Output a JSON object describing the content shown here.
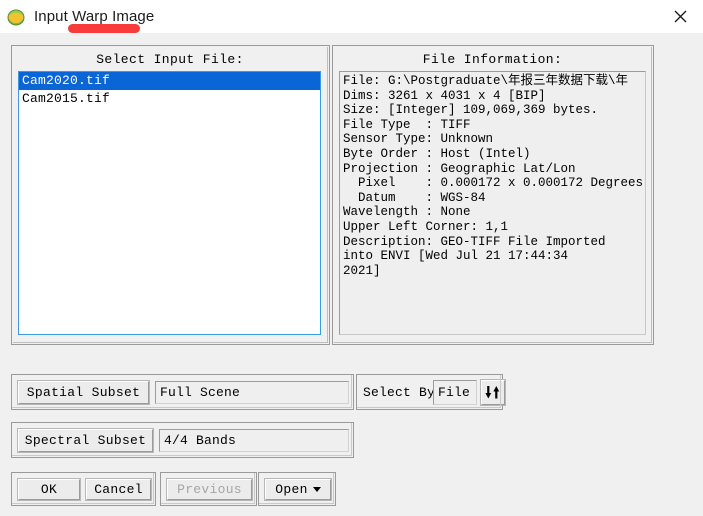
{
  "window": {
    "title": "Input Warp Image",
    "app_icon": "envi-globe-icon",
    "close_icon": "close-icon",
    "annotation_color": "#f93b3b"
  },
  "left_panel": {
    "header": "Select Input File:",
    "files": [
      {
        "name": "Cam2020.tif",
        "selected": true
      },
      {
        "name": "Cam2015.tif",
        "selected": false
      }
    ]
  },
  "right_panel": {
    "header": "File Information:",
    "lines": [
      "File: G:\\Postgraduate\\年报三年数据下载\\年",
      "Dims: 3261 x 4031 x 4 [BIP]",
      "Size: [Integer] 109,069,369 bytes.",
      "File Type  : TIFF",
      "Sensor Type: Unknown",
      "Byte Order : Host (Intel)",
      "Projection : Geographic Lat/Lon",
      "  Pixel    : 0.000172 x 0.000172 Degrees",
      "  Datum    : WGS-84",
      "Wavelength : None",
      "Upper Left Corner: 1,1",
      "Description: GEO-TIFF File Imported",
      "into ENVI [Wed Jul 21 17:44:34",
      "2021]"
    ]
  },
  "controls": {
    "spatial_subset_label": "Spatial Subset",
    "spatial_subset_value": "Full Scene",
    "select_by_label": "Select By",
    "select_by_value": "File",
    "select_by_toggle_icon": "down-up-arrows-icon",
    "spectral_subset_label": "Spectral Subset",
    "spectral_subset_value": "4/4 Bands"
  },
  "buttons": {
    "ok": "OK",
    "cancel": "Cancel",
    "previous": "Previous",
    "open": "Open",
    "open_caret_icon": "caret-down-icon"
  }
}
